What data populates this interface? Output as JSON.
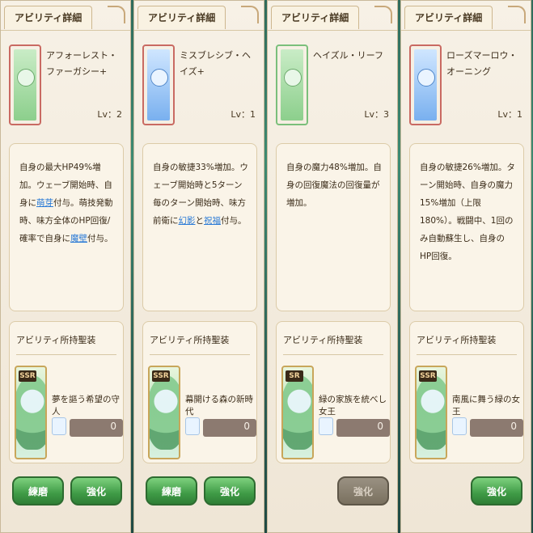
{
  "panels": [
    {
      "header": "アビリティ詳細",
      "ability_name": "アフォーレスト・ファーガシー+",
      "level": "Lv：2",
      "description_parts": [
        "自身の最大HP49%増加。ウェーブ開始時、自身に",
        "萌芽",
        "付与。萌技発動時、味方全体のHP回復/確率で自身に",
        "魔壁",
        "付与。"
      ],
      "equip_title": "アビリティ所持聖装",
      "equip_rarity": "SSR",
      "equip_name": "夢を謳う希望の守人",
      "equip_value": "0",
      "buttons": [
        "練磨",
        "強化"
      ]
    },
    {
      "header": "アビリティ詳細",
      "ability_name": "ミスブレシブ・ヘイズ+",
      "level": "Lv：1",
      "description_parts": [
        "自身の敏捷33%増加。ウェーブ開始時と5ターン毎のターン開始時、味方前衛に",
        "幻影",
        "と",
        "祝福",
        "付与。"
      ],
      "equip_title": "アビリティ所持聖装",
      "equip_rarity": "SSR",
      "equip_name": "幕開ける森の新時代",
      "equip_value": "0",
      "buttons": [
        "練磨",
        "強化"
      ]
    },
    {
      "header": "アビリティ詳細",
      "ability_name": "ヘイズル・リーフ",
      "level": "Lv：3",
      "description": "自身の魔力48%増加。自身の回復魔法の回復量が増加。",
      "equip_title": "アビリティ所持聖装",
      "equip_rarity": "SR",
      "equip_name": "緑の家族を統べし女王",
      "equip_value": "0",
      "buttons": [
        "強化"
      ]
    },
    {
      "header": "アビリティ詳細",
      "ability_name": "ローズマーロウ・オーニング",
      "level": "Lv：1",
      "description": "自身の敏捷26%増加。ターン開始時、自身の魔力15%増加（上限180%）。戦闘中、1回のみ自動蘇生し、自身のHP回復。",
      "equip_title": "アビリティ所持聖装",
      "equip_rarity": "SSR",
      "equip_name": "南風に舞う緑の女王",
      "equip_value": "0",
      "buttons": [
        "強化"
      ]
    }
  ],
  "icons": {
    "ability": "ability-icon",
    "equip": "holy-equipment-icon",
    "mini": "sub-icon"
  },
  "colors": {
    "panel_bg": "#f7f1e6",
    "button_green": "#3f9b46",
    "button_disabled": "#7a705f",
    "keyword_blue": "#2a7ad6"
  }
}
